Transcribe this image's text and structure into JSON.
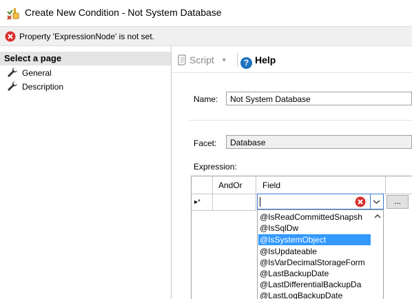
{
  "window": {
    "title": "Create New Condition - Not System Database",
    "app_icon": "condition-icon"
  },
  "error": {
    "icon": "error-icon",
    "message": "Property 'ExpressionNode' is not set."
  },
  "sidebar": {
    "header": "Select a page",
    "items": [
      {
        "label": "General",
        "icon": "wrench-icon"
      },
      {
        "label": "Description",
        "icon": "wrench-icon"
      }
    ]
  },
  "toolbar": {
    "script_label": "Script",
    "help_label": "Help"
  },
  "form": {
    "name_label": "Name:",
    "name_value": "Not System Database",
    "facet_label": "Facet:",
    "facet_value": "Database",
    "expression_label": "Expression:"
  },
  "grid": {
    "columns": [
      "AndOr",
      "Field"
    ],
    "row_marker": "▸*",
    "ellipsis_label": "..."
  },
  "dropdown": {
    "options": [
      "@IsReadCommittedSnapsh",
      "@IsSqlDw",
      "@IsSystemObject",
      "@IsUpdateable",
      "@IsVarDecimalStorageForm",
      "@LastBackupDate",
      "@LastDifferentialBackupDa",
      "@LastLogBackupDate"
    ],
    "selected": "@IsSystemObject"
  },
  "colors": {
    "error_red": "#d9302c",
    "selection_blue": "#3399ff",
    "focus_border": "#3a7bd5",
    "help_blue": "#1e73be"
  }
}
